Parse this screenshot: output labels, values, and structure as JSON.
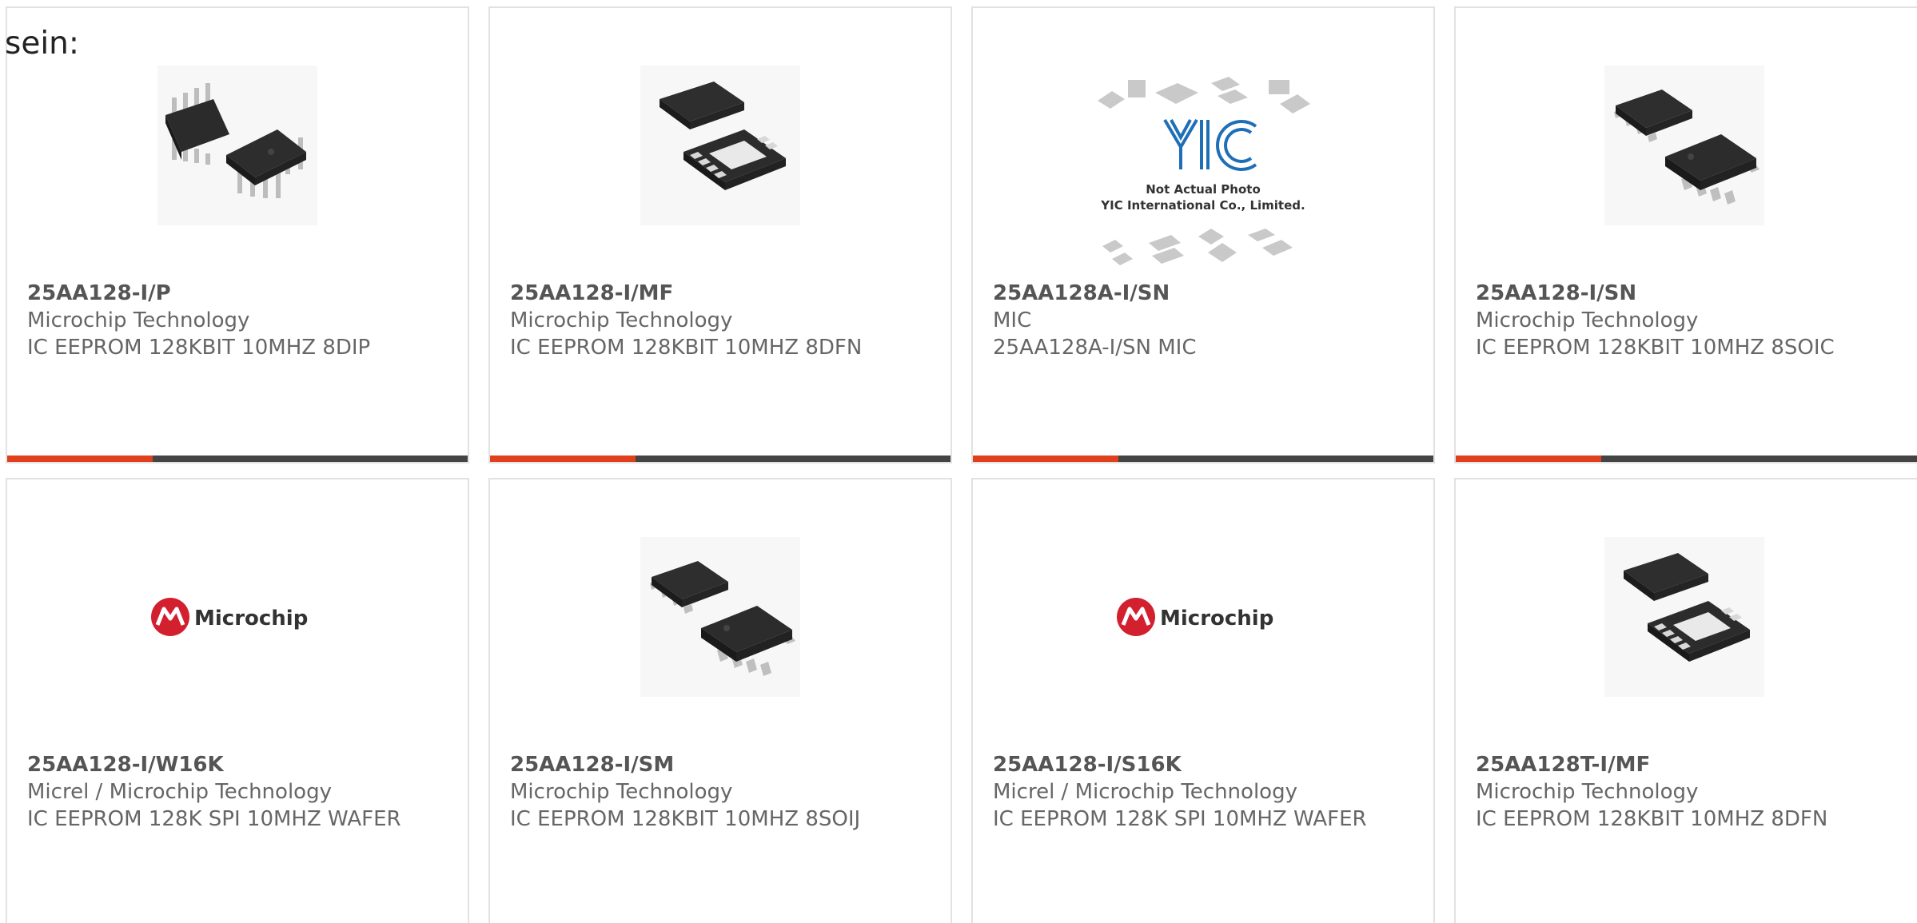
{
  "lead_text": "sein:",
  "colors": {
    "accent_bar": "#e0401c",
    "bar_track": "#444444",
    "card_border": "#e2e2e2",
    "text_muted": "#666666",
    "microchip_red": "#d2202f"
  },
  "products": [
    {
      "part": "25AA128-I/P",
      "manufacturer": "Microchip Technology",
      "description": "IC EEPROM 128KBIT 10MHZ 8DIP",
      "image": "dip8-chip-photo",
      "accent_bar": true
    },
    {
      "part": "25AA128-I/MF",
      "manufacturer": "Microchip Technology",
      "description": "IC EEPROM 128KBIT 10MHZ 8DFN",
      "image": "dfn8-chip-photo",
      "accent_bar": true
    },
    {
      "part": "25AA128A-I/SN",
      "manufacturer": "MIC",
      "description": "25AA128A-I/SN MIC",
      "image": "yic-placeholder-photo",
      "image_caption_line1": "Not Actual Photo",
      "image_caption_line2": "YIC International Co., Limited.",
      "image_logo_text": "YIC",
      "accent_bar": true
    },
    {
      "part": "25AA128-I/SN",
      "manufacturer": "Microchip Technology",
      "description": "IC EEPROM 128KBIT 10MHZ 8SOIC",
      "image": "soic8-chip-photo",
      "accent_bar": true
    },
    {
      "part": "25AA128-I/W16K",
      "manufacturer": "Micrel / Microchip Technology",
      "description": "IC EEPROM 128K SPI 10MHZ WAFER",
      "image": "microchip-logo",
      "image_logo_text": "Microchip",
      "accent_bar": false
    },
    {
      "part": "25AA128-I/SM",
      "manufacturer": "Microchip Technology",
      "description": "IC EEPROM 128KBIT 10MHZ 8SOIJ",
      "image": "soij8-chip-photo",
      "accent_bar": false
    },
    {
      "part": "25AA128-I/S16K",
      "manufacturer": "Micrel / Microchip Technology",
      "description": "IC EEPROM 128K SPI 10MHZ WAFER",
      "image": "microchip-logo",
      "image_logo_text": "Microchip",
      "accent_bar": false
    },
    {
      "part": "25AA128T-I/MF",
      "manufacturer": "Microchip Technology",
      "description": "IC EEPROM 128KBIT 10MHZ 8DFN",
      "image": "dfn8-chip-photo",
      "accent_bar": false
    }
  ]
}
